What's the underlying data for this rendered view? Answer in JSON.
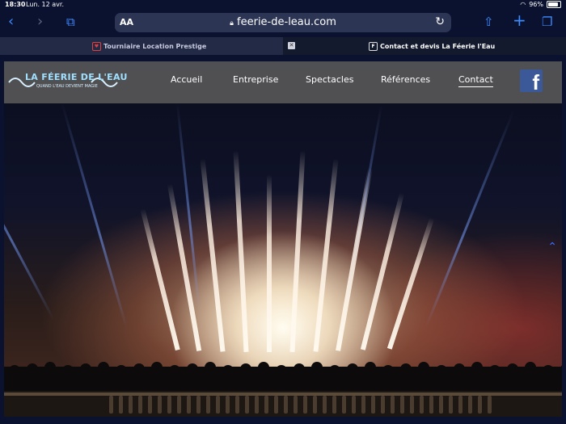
{
  "status": {
    "time": "18:30",
    "date": "Lun. 12 avr.",
    "battery": "96%"
  },
  "toolbar": {
    "aa_label": "AA",
    "url": "feerie-de-leau.com"
  },
  "tabs": [
    {
      "title": "Tourniaire Location Prestige"
    },
    {
      "title": "Contact et devis La Féerie l'Eau",
      "favicon": "F"
    }
  ],
  "site": {
    "logo_text": "LA FÉERIE DE L'EAU",
    "logo_sub": "QUAND L'EAU DEVIENT MAGIE",
    "menu": [
      {
        "label": "Accueil"
      },
      {
        "label": "Entreprise"
      },
      {
        "label": "Spectacles"
      },
      {
        "label": "Références"
      },
      {
        "label": "Contact"
      }
    ],
    "facebook_glyph": "f"
  },
  "colors": {
    "accent": "#3d8bff",
    "facebook": "#3b5998",
    "nav_bg": "#5f5f5f"
  }
}
